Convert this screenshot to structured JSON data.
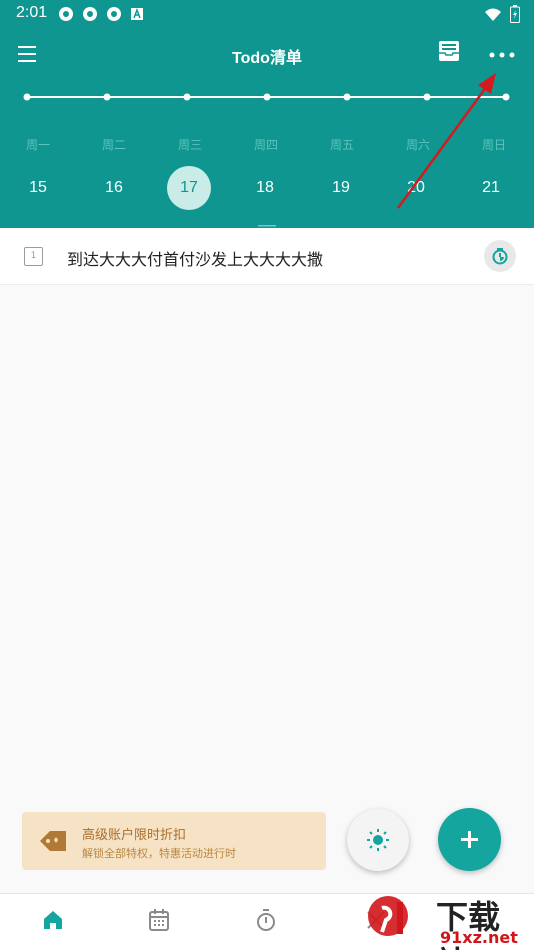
{
  "status_bar": {
    "time": "2:01"
  },
  "header": {
    "title": "Todo清单"
  },
  "week": {
    "days": [
      "周一",
      "周二",
      "周三",
      "周四",
      "周五",
      "周六",
      "周日"
    ],
    "dates": [
      "15",
      "16",
      "17",
      "18",
      "19",
      "20",
      "21"
    ],
    "selected_index": 2
  },
  "task": {
    "rank": "1",
    "text": "到达大大大付首付沙发上大大大大撒"
  },
  "promo": {
    "title": "高级账户限时折扣",
    "subtitle": "解锁全部特权，特惠活动进行时"
  },
  "watermark": {
    "brand": "下载站",
    "url": "91xz.net"
  },
  "colors": {
    "primary": "#0f9690",
    "fab": "#14a59e",
    "promo_bg": "#f6e2c4",
    "annotation_arrow": "#d6191e"
  }
}
